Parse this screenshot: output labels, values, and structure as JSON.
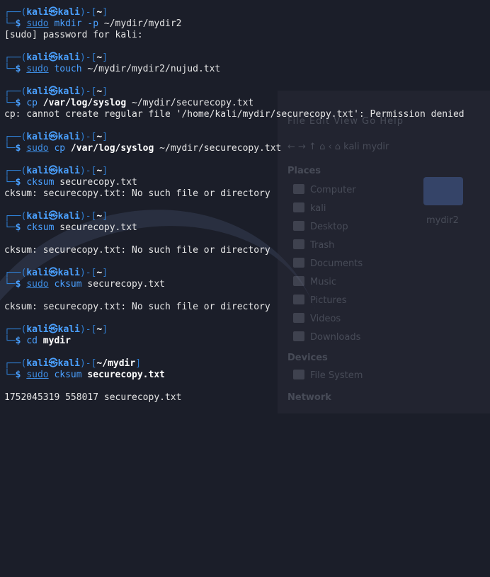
{
  "prompt": {
    "top": "┌──(",
    "user": "kali㉿kali",
    "mid": ")-[",
    "close": "]",
    "bottom": "└─",
    "dollar": "$ "
  },
  "background": {
    "menu": "File  Edit  View  Go  Help",
    "toolbar": "←  →  ↑  ⌂  ‹  ⌂ kali   mydir",
    "places_heading": "Places",
    "places": [
      "Computer",
      "kali",
      "Desktop",
      "Trash",
      "Documents",
      "Music",
      "Pictures",
      "Videos",
      "Downloads"
    ],
    "devices_heading": "Devices",
    "devices": [
      "File System"
    ],
    "network_heading": "Network",
    "folder_label": "mydir2"
  },
  "blocks": [
    {
      "dir": "~",
      "cmd": [
        {
          "t": "sudo",
          "c": "c-sudo"
        },
        {
          "t": " mkdir",
          "c": "c-cmd"
        },
        {
          "t": " -p",
          "c": "c-cmd"
        },
        {
          "t": " ~/mydir/mydir2",
          "c": "c-arg"
        }
      ],
      "output": [
        "[sudo] password for kali:"
      ]
    },
    {
      "dir": "~",
      "cmd": [
        {
          "t": "sudo",
          "c": "c-sudo"
        },
        {
          "t": " touch",
          "c": "c-cmd"
        },
        {
          "t": " ~/mydir/mydir2/nujud.txt",
          "c": "c-arg"
        }
      ],
      "output": []
    },
    {
      "dir": "~",
      "cmd": [
        {
          "t": "cp",
          "c": "c-cmd"
        },
        {
          "t": " /var/log/syslog",
          "c": "c-path"
        },
        {
          "t": " ~/mydir/securecopy.txt",
          "c": "c-arg"
        }
      ],
      "output": [
        "cp: cannot create regular file '/home/kali/mydir/securecopy.txt': Permission denied"
      ]
    },
    {
      "dir": "~",
      "cmd": [
        {
          "t": "sudo",
          "c": "c-sudo"
        },
        {
          "t": " cp",
          "c": "c-cmd"
        },
        {
          "t": " /var/log/syslog",
          "c": "c-path"
        },
        {
          "t": " ~/mydir/securecopy.txt",
          "c": "c-arg"
        }
      ],
      "output": []
    },
    {
      "dir": "~",
      "cmd": [
        {
          "t": "cksum",
          "c": "c-cmd"
        },
        {
          "t": " securecopy.txt",
          "c": "c-arg"
        }
      ],
      "output": [
        "cksum: securecopy.txt: No such file or directory"
      ]
    },
    {
      "dir": "~",
      "cmd": [
        {
          "t": "cksum",
          "c": "c-cmd"
        },
        {
          "t": " securecopy.txt",
          "c": "c-arg"
        }
      ],
      "output": [
        "",
        "cksum: securecopy.txt: No such file or directory"
      ]
    },
    {
      "dir": "~",
      "cmd": [
        {
          "t": "sudo",
          "c": "c-sudo"
        },
        {
          "t": " cksum",
          "c": "c-cmd"
        },
        {
          "t": " securecopy.txt",
          "c": "c-arg"
        }
      ],
      "output": [
        "",
        "cksum: securecopy.txt: No such file or directory"
      ]
    },
    {
      "dir": "~",
      "cmd": [
        {
          "t": "cd",
          "c": "c-cmd"
        },
        {
          "t": " mydir",
          "c": "c-path"
        }
      ],
      "output": []
    },
    {
      "dir": "~/mydir",
      "cmd": [
        {
          "t": "sudo",
          "c": "c-sudo"
        },
        {
          "t": " cksum",
          "c": "c-cmd"
        },
        {
          "t": " securecopy.txt",
          "c": "c-path"
        }
      ],
      "output": [
        "",
        "1752045319 558017 securecopy.txt"
      ]
    }
  ]
}
